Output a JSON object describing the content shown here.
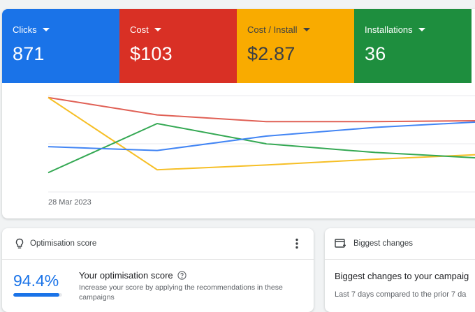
{
  "metrics": [
    {
      "label": "Clicks",
      "value": "871",
      "color": "#1a73e8",
      "text_color": "#ffffff"
    },
    {
      "label": "Cost",
      "value": "$103",
      "color": "#d93025",
      "text_color": "#ffffff"
    },
    {
      "label": "Cost / Install",
      "value": "$2.87",
      "color": "#f9ab00",
      "text_color": "#3c4043"
    },
    {
      "label": "Installations",
      "value": "36",
      "color": "#1e8e3e",
      "text_color": "#ffffff"
    }
  ],
  "chart_data": {
    "type": "line",
    "x": [
      "28 Mar 2023",
      "",
      "",
      "",
      ""
    ],
    "x_label_shown": "28 Mar 2023",
    "ylim": [
      0,
      1
    ],
    "grid": true,
    "series": [
      {
        "metric": "Clicks",
        "color": "#4285f4",
        "values": [
          0.47,
          0.43,
          0.58,
          0.67,
          0.73
        ]
      },
      {
        "metric": "Cost",
        "color": "#e06055",
        "values": [
          0.98,
          0.8,
          0.73,
          0.73,
          0.74
        ]
      },
      {
        "metric": "Cost / Install",
        "color": "#f6bf26",
        "values": [
          0.98,
          0.23,
          0.28,
          0.34,
          0.39
        ]
      },
      {
        "metric": "Installations",
        "color": "#34a853",
        "values": [
          0.2,
          0.71,
          0.5,
          0.41,
          0.35
        ]
      }
    ]
  },
  "optimisation": {
    "header": "Optimisation score",
    "score": "94.4%",
    "score_fraction": 0.944,
    "title": "Your optimisation score",
    "description": "Increase your score by applying the recommendations in these campaigns"
  },
  "changes": {
    "header": "Biggest changes",
    "title": "Biggest changes to your campaig",
    "subtitle": "Last 7 days compared to the prior 7 da"
  }
}
